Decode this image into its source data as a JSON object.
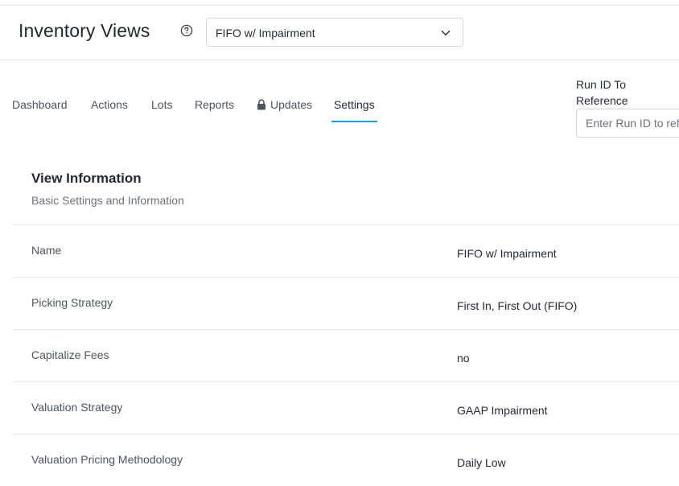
{
  "header": {
    "title": "Inventory Views",
    "help_icon": "question-circle-icon",
    "view_select": {
      "value": "FIFO w/ Impairment",
      "icon": "chevron-down-icon"
    }
  },
  "tabs": [
    {
      "label": "Dashboard",
      "active": false
    },
    {
      "label": "Actions",
      "active": false
    },
    {
      "label": "Lots",
      "active": false
    },
    {
      "label": "Reports",
      "active": false
    },
    {
      "label": "Updates",
      "active": false,
      "icon": "lock-icon"
    },
    {
      "label": "Settings",
      "active": true
    }
  ],
  "run_id": {
    "label": "Run ID To Reference",
    "placeholder": "Enter Run ID to reference"
  },
  "section": {
    "title": "View Information",
    "subtitle": "Basic Settings and Information"
  },
  "settings": [
    {
      "label": "Name",
      "value": "FIFO w/ Impairment"
    },
    {
      "label": "Picking Strategy",
      "value": "First In, First Out (FIFO)"
    },
    {
      "label": "Capitalize Fees",
      "value": "no"
    },
    {
      "label": "Valuation Strategy",
      "value": "GAAP Impairment"
    },
    {
      "label": "Valuation Pricing Methodology",
      "value": "Daily Low"
    }
  ],
  "colors": {
    "accent": "#0ea5e9",
    "border": "#e5e7eb",
    "text": "#1f2937",
    "muted": "#6b7280"
  }
}
